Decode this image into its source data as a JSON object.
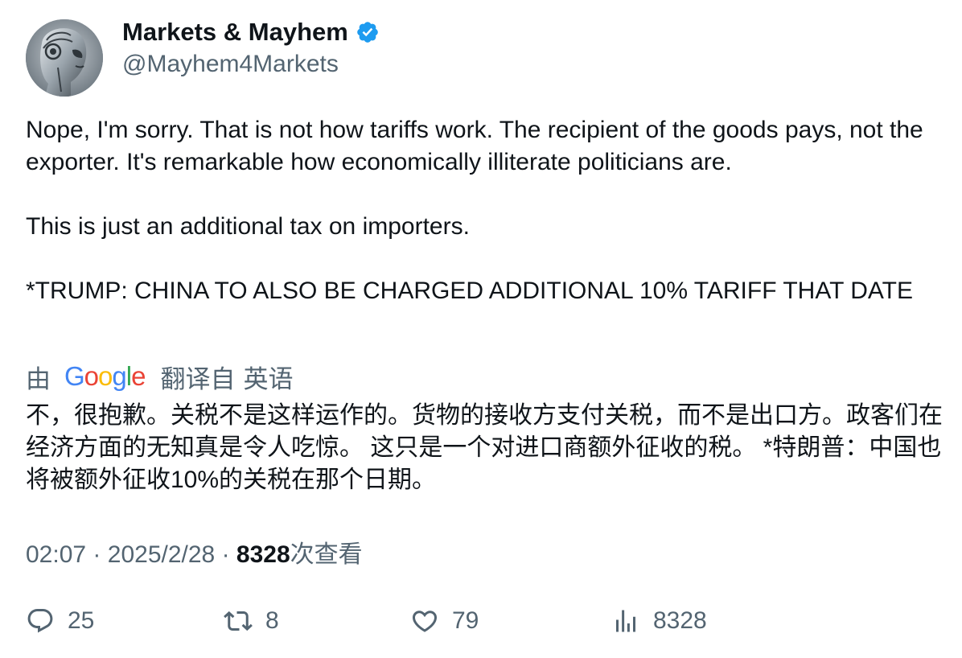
{
  "author": {
    "name": "Markets & Mayhem",
    "handle": "@Mayhem4Markets",
    "verified": true,
    "avatar_icon": "robot-head-avatar"
  },
  "tweet": {
    "paragraphs": [
      "Nope, I'm sorry. That is not how tariffs work. The recipient of the goods pays, not the exporter. It's remarkable how economically illiterate politicians are.",
      "This is just an additional tax on importers.",
      "*TRUMP: CHINA TO ALSO BE CHARGED ADDITIONAL 10% TARIFF THAT DATE"
    ]
  },
  "translation": {
    "by": "由",
    "provider": "Google",
    "translated_from": "翻译自",
    "language": "英语",
    "text": "不，很抱歉。关税不是这样运作的。货物的接收方支付关税，而不是出口方。政客们在经济方面的无知真是令人吃惊。 这只是一个对进口商额外征收的税。 *特朗普：中国也将被额外征收10%的关税在那个日期。"
  },
  "meta": {
    "time": "02:07",
    "separator": "·",
    "date": "2025/2/28",
    "views_count": "8328",
    "views_label": "次查看"
  },
  "actions": {
    "replies": "25",
    "retweets": "8",
    "likes": "79",
    "views": "8328"
  },
  "colors": {
    "text": "#0f1419",
    "secondary": "#536471",
    "verified": "#1d9bf0"
  }
}
